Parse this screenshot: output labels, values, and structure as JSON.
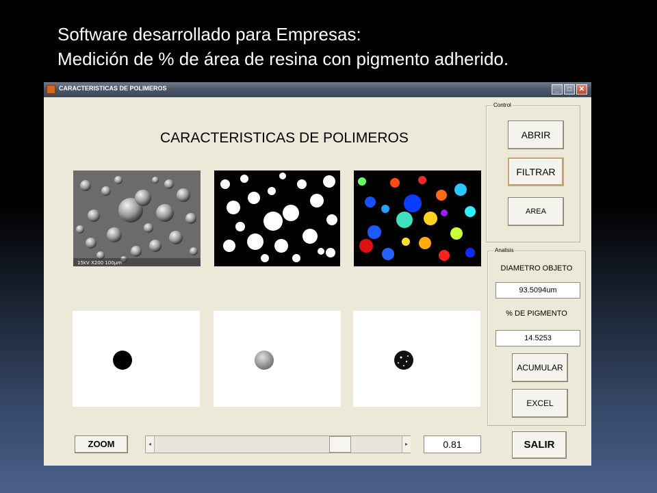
{
  "slide": {
    "line1": "Software desarrollado para Empresas:",
    "line2": "Medición de % de área de resina con pigmento adherido."
  },
  "window": {
    "title": "CARACTERISTICAS DE POLIMEROS",
    "min": "_",
    "max": "□",
    "close": "✕"
  },
  "app": {
    "title": "CARACTERISTICAS DE POLIMEROS"
  },
  "control": {
    "label": "Control",
    "abrir": "ABRIR",
    "filtrar": "FILTRAR",
    "area": "AREA"
  },
  "analisis": {
    "label": "Analisis",
    "diametro_label": "DIAMETRO OBJETO",
    "diametro_value": "93.5094um",
    "pigmento_label": "% DE PIGMENTO",
    "pigmento_value": "14.5253",
    "acumular": "ACUMULAR",
    "excel": "EXCEL"
  },
  "bottom": {
    "zoom": "ZOOM",
    "zoom_value": "0.81",
    "salir": "SALIR",
    "arrow_left": "◂",
    "arrow_right": "▸"
  },
  "micrograph_caption": "15kV   X200   100µm",
  "colors": {
    "window_bg": "#ece9d8",
    "focus_border": "#d6a062",
    "titlebar": "#4d596b"
  }
}
